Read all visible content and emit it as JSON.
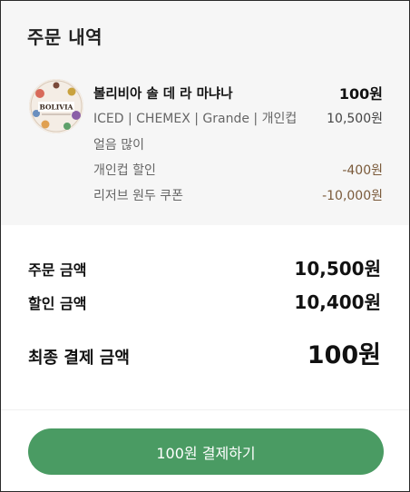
{
  "section_title": "주문 내역",
  "item": {
    "logo_icon": "bolivia-coffee-logo-icon",
    "logo_text": "BOLIVIA",
    "name": "볼리비아 솔 데 라 마냐나",
    "price": "100원",
    "options": "ICED | CHEMEX | Grande | 개인컵",
    "options_price": "10,500원",
    "extra": "얼음 많이",
    "discounts": [
      {
        "label": "개인컵 할인",
        "value": "-400원"
      },
      {
        "label": "리저브 원두 쿠폰",
        "value": "-10,000원"
      }
    ]
  },
  "summary": {
    "order_label": "주문 금액",
    "order_value": "10,500원",
    "discount_label": "할인 금액",
    "discount_value": "10,400원",
    "final_label": "최종 결제 금액",
    "final_value": "100원"
  },
  "pay_button_label": "100원 결제하기",
  "colors": {
    "accent": "#4a9b63",
    "discount": "#7a5a3a",
    "panel_bg": "#f6f6f6"
  }
}
